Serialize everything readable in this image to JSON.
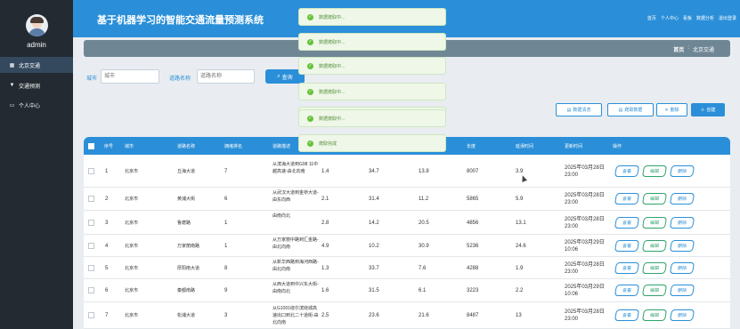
{
  "sidebar": {
    "username": "admin",
    "items": [
      {
        "label": "北京交通",
        "icon": "grid-icon",
        "active": true
      },
      {
        "label": "交通预测",
        "icon": "pin-icon",
        "active": false
      },
      {
        "label": "个人中心",
        "icon": "card-icon",
        "active": false
      }
    ]
  },
  "header": {
    "title": "基于机器学习的智能交通流量预测系统",
    "links": [
      "首页",
      "个人中心",
      "看板",
      "数据分析",
      "退出登录"
    ]
  },
  "breadcrumb": {
    "home": "首页",
    "sep": ":",
    "current": "北京交通"
  },
  "search": {
    "city_label": "城市",
    "city_placeholder": "城市",
    "road_label": "道路名称",
    "road_placeholder": "道路名称",
    "button": "查询"
  },
  "actions": {
    "clean": "数据清洗",
    "crawl": "爬取数据",
    "delete": "删除",
    "create": "创建"
  },
  "table": {
    "headers": [
      "序号",
      "城市",
      "道路名称",
      "拥堵排名",
      "道路描述",
      "",
      "",
      "",
      "长度",
      "延误时间",
      "更新时间",
      "操作"
    ],
    "op_labels": {
      "view": "查看",
      "edit": "编辑",
      "delete": "删除"
    },
    "rows": [
      {
        "no": "1",
        "city": "北京市",
        "road": "丘海大道",
        "rank": "7",
        "desc": "从滨海大道到G98 11中越高速-由北向南",
        "c1": "1.4",
        "c2": "34.7",
        "c3": "13.8",
        "len": "8007",
        "delay": "3.9",
        "updated": "2025年03月28日 23:00"
      },
      {
        "no": "2",
        "city": "北京市",
        "road": "黄浦大街",
        "rank": "6",
        "desc": "从武汉大道到金桥大道-由东向西",
        "c1": "2.1",
        "c2": "31.4",
        "c3": "11.2",
        "len": "5865",
        "delay": "5.9",
        "updated": "2025年03月28日 23:00"
      },
      {
        "no": "3",
        "city": "北京市",
        "road": "鲁磨路",
        "rank": "1",
        "desc": "由南向北",
        "c1": "2.8",
        "c2": "14.2",
        "c3": "20.5",
        "len": "4856",
        "delay": "13.1",
        "updated": "2025年03月28日 23:00"
      },
      {
        "no": "4",
        "city": "北京市",
        "road": "万家丽南路",
        "rank": "1",
        "desc": "从万家丽中路到汇金路-由北向南",
        "c1": "4.9",
        "c2": "10.2",
        "c3": "30.9",
        "len": "5236",
        "delay": "24.6",
        "updated": "2025年03月29日 10:06"
      },
      {
        "no": "5",
        "city": "北京市",
        "road": "厚阳南大道",
        "rank": "8",
        "desc": "从新华西路到海河西路-由北向南",
        "c1": "1.3",
        "c2": "33.7",
        "c3": "7.6",
        "len": "4288",
        "delay": "1.9",
        "updated": "2025年03月28日 23:00"
      },
      {
        "no": "6",
        "city": "北京市",
        "road": "秦都南路",
        "rank": "9",
        "desc": "从西大道到中兴东大街-由南向北",
        "c1": "1.6",
        "c2": "31.5",
        "c3": "6.1",
        "len": "3223",
        "delay": "2.2",
        "updated": "2025年03月29日 10:06"
      },
      {
        "no": "7",
        "city": "北京市",
        "road": "松浦大道",
        "rank": "3",
        "desc": "从G1001绕尔滨绕城高速出口到北二十道街-由北向南",
        "c1": "2.5",
        "c2": "23.6",
        "c3": "21.6",
        "len": "8487",
        "delay": "13",
        "updated": "2025年03月28日 23:00"
      }
    ]
  },
  "toasts": [
    "数据爬取中...",
    "数据爬取中...",
    "数据爬取中...",
    "数据爬取中...",
    "数据爬取中...",
    "数据爬取中...",
    "爬取完成"
  ],
  "colors": {
    "primary": "#2a8fd8",
    "sidebar": "#232a31",
    "success": "#67c23a"
  }
}
